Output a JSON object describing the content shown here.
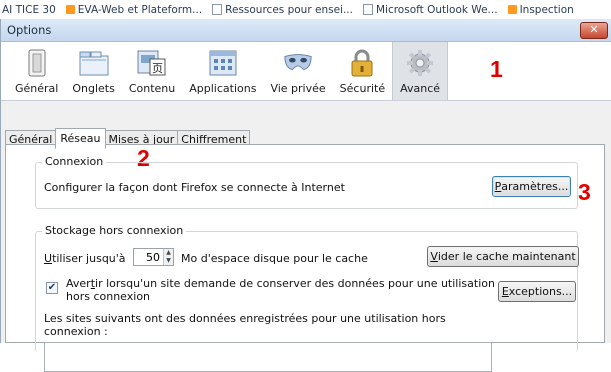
{
  "taskbar": {
    "items": [
      {
        "label": "AI TICE 30"
      },
      {
        "label": "EVA-Web et Plateform..."
      },
      {
        "label": "Ressources pour ensei..."
      },
      {
        "label": "Microsoft Outlook We..."
      },
      {
        "label": "Inspection"
      }
    ]
  },
  "window": {
    "title": "Options",
    "close_label": "✕"
  },
  "categories": [
    {
      "label": "Général",
      "icon": "switch-icon"
    },
    {
      "label": "Onglets",
      "icon": "tabs-icon"
    },
    {
      "label": "Contenu",
      "icon": "content-icon"
    },
    {
      "label": "Applications",
      "icon": "applications-icon"
    },
    {
      "label": "Vie privée",
      "icon": "mask-icon"
    },
    {
      "label": "Sécurité",
      "icon": "padlock-icon"
    },
    {
      "label": "Avancé",
      "icon": "gear-icon",
      "active": true
    }
  ],
  "subtabs": [
    "Général",
    "Réseau",
    "Mises à jour",
    "Chiffrement"
  ],
  "active_subtab": "Réseau",
  "annotations": {
    "one": "1",
    "two": "2",
    "three": "3",
    "color": "#e10000"
  },
  "connexion": {
    "legend": "Connexion",
    "description": "Configurer la façon dont Firefox se connecte à Internet",
    "button_underlined": "P",
    "button_rest": "aramètres..."
  },
  "storage": {
    "legend": "Stockage hors connexion",
    "use_up_to_u": "U",
    "use_up_to_rest": "tiliser jusqu'à",
    "cache_value": "50",
    "cache_unit": "Mo d'espace disque pour le cache",
    "clear_btn_u": "V",
    "clear_btn_rest": "ider le cache maintenant",
    "warn_checked": true,
    "warn_line1_pre": "Aver",
    "warn_line1_u": "t",
    "warn_line1_post": "ir lorsqu'un site demande de conserver des données pour une utilisation",
    "warn_line2": "hors connexion",
    "exceptions_u": "E",
    "exceptions_rest": "xceptions...",
    "sites_line1": "Les sites suivants ont des données enregistrées pour une utilisation hors",
    "sites_line2": "connexion :"
  }
}
